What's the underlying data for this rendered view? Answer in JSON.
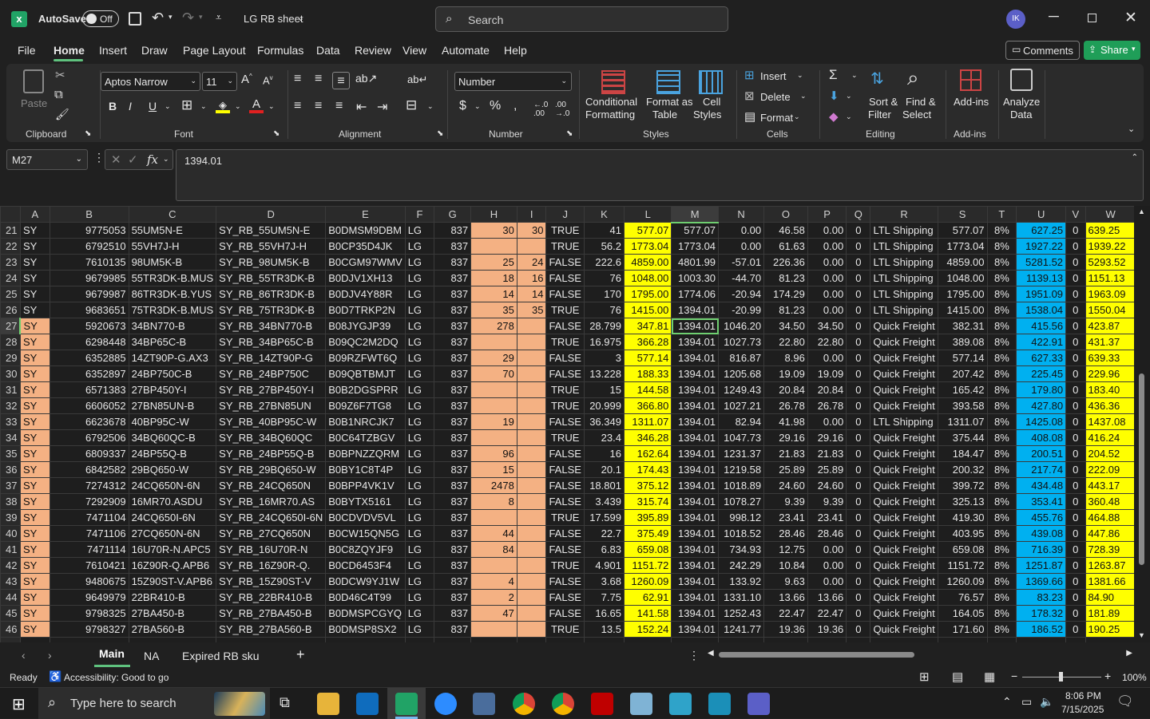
{
  "window": {
    "autosave_label": "AutoSave",
    "autosave_state": "Off",
    "title": "LG RB sheet",
    "search_placeholder": "Search",
    "user_initials": "IK"
  },
  "menu": {
    "items": [
      "File",
      "Home",
      "Insert",
      "Draw",
      "Page Layout",
      "Formulas",
      "Data",
      "Review",
      "View",
      "Automate",
      "Help"
    ],
    "active": "Home",
    "comments": "Comments",
    "share": "Share"
  },
  "ribbon": {
    "paste": "Paste",
    "font_name": "Aptos Narrow",
    "font_size": "11",
    "number_format": "Number",
    "conditional_formatting": [
      "Conditional",
      "Formatting"
    ],
    "format_as_table": [
      "Format as",
      "Table"
    ],
    "cell_styles": [
      "Cell",
      "Styles"
    ],
    "insert": "Insert",
    "delete": "Delete",
    "format": "Format",
    "sort_filter": [
      "Sort &",
      "Filter"
    ],
    "find_select": [
      "Find &",
      "Select"
    ],
    "add_ins": "Add-ins",
    "analyze": [
      "Analyze",
      "Data"
    ],
    "groups": [
      "Clipboard",
      "Font",
      "Alignment",
      "Number",
      "Styles",
      "Cells",
      "Editing",
      "Add-ins"
    ]
  },
  "formula": {
    "name_box": "M27",
    "value": "1394.01"
  },
  "columns": [
    "A",
    "B",
    "C",
    "D",
    "E",
    "F",
    "G",
    "H",
    "I",
    "J",
    "K",
    "L",
    "M",
    "N",
    "O",
    "P",
    "Q",
    "R",
    "S",
    "T",
    "U",
    "V",
    "W"
  ],
  "rows": [
    {
      "r": "21",
      "c": [
        "SY",
        "9775053",
        "55UM5N-E",
        "SY_RB_55UM5N-E",
        "B0DMSM9DBM",
        "LG",
        "837",
        "30",
        "30",
        "TRUE",
        "41",
        "577.07",
        "577.07",
        "0.00",
        "46.58",
        "0.00",
        "0",
        "LTL Shipping",
        "577.07",
        "8%",
        "627.25",
        "0",
        "639.25"
      ]
    },
    {
      "r": "22",
      "c": [
        "SY",
        "6792510",
        "55VH7J-H",
        "SY_RB_55VH7J-H",
        "B0CP35D4JK",
        "LG",
        "837",
        "",
        "",
        "TRUE",
        "56.2",
        "1773.04",
        "1773.04",
        "0.00",
        "61.63",
        "0.00",
        "0",
        "LTL Shipping",
        "1773.04",
        "8%",
        "1927.22",
        "0",
        "1939.22"
      ]
    },
    {
      "r": "23",
      "c": [
        "SY",
        "7610135",
        "98UM5K-B",
        "SY_RB_98UM5K-B",
        "B0CGM97WMV",
        "LG",
        "837",
        "25",
        "24",
        "FALSE",
        "222.6",
        "4859.00",
        "4801.99",
        "-57.01",
        "226.36",
        "0.00",
        "0",
        "LTL Shipping",
        "4859.00",
        "8%",
        "5281.52",
        "0",
        "5293.52"
      ]
    },
    {
      "r": "24",
      "c": [
        "SY",
        "9679985",
        "55TR3DK-B.MUS",
        "SY_RB_55TR3DK-B",
        "B0DJV1XH13",
        "LG",
        "837",
        "18",
        "16",
        "FALSE",
        "76",
        "1048.00",
        "1003.30",
        "-44.70",
        "81.23",
        "0.00",
        "0",
        "LTL Shipping",
        "1048.00",
        "8%",
        "1139.13",
        "0",
        "1151.13"
      ]
    },
    {
      "r": "25",
      "c": [
        "SY",
        "9679987",
        "86TR3DK-B.YUS",
        "SY_RB_86TR3DK-B",
        "B0DJV4Y88R",
        "LG",
        "837",
        "14",
        "14",
        "FALSE",
        "170",
        "1795.00",
        "1774.06",
        "-20.94",
        "174.29",
        "0.00",
        "0",
        "LTL Shipping",
        "1795.00",
        "8%",
        "1951.09",
        "0",
        "1963.09"
      ]
    },
    {
      "r": "26",
      "c": [
        "SY",
        "9683651",
        "75TR3DK-B.MUS",
        "SY_RB_75TR3DK-B",
        "B0D7TRKP2N",
        "LG",
        "837",
        "35",
        "35",
        "TRUE",
        "76",
        "1415.00",
        "1394.01",
        "-20.99",
        "81.23",
        "0.00",
        "0",
        "LTL Shipping",
        "1415.00",
        "8%",
        "1538.04",
        "0",
        "1550.04"
      ]
    },
    {
      "r": "27",
      "c": [
        "SY",
        "5920673",
        "34BN770-B",
        "SY_RB_34BN770-B",
        "B08JYGJP39",
        "LG",
        "837",
        "278",
        "",
        "FALSE",
        "28.799",
        "347.81",
        "1394.01",
        "1046.20",
        "34.50",
        "34.50",
        "0",
        "Quick Freight",
        "382.31",
        "8%",
        "415.56",
        "0",
        "423.87"
      ]
    },
    {
      "r": "28",
      "c": [
        "SY",
        "6298448",
        "34BP65C-B",
        "SY_RB_34BP65C-B",
        "B09QC2M2DQ",
        "LG",
        "837",
        "",
        "",
        "TRUE",
        "16.975",
        "366.28",
        "1394.01",
        "1027.73",
        "22.80",
        "22.80",
        "0",
        "Quick Freight",
        "389.08",
        "8%",
        "422.91",
        "0",
        "431.37"
      ]
    },
    {
      "r": "29",
      "c": [
        "SY",
        "6352885",
        "14ZT90P-G.AX3",
        "SY_RB_14ZT90P-G",
        "B09RZFWT6Q",
        "LG",
        "837",
        "29",
        "",
        "FALSE",
        "3",
        "577.14",
        "1394.01",
        "816.87",
        "8.96",
        "0.00",
        "0",
        "Quick Freight",
        "577.14",
        "8%",
        "627.33",
        "0",
        "639.33"
      ]
    },
    {
      "r": "30",
      "c": [
        "SY",
        "6352897",
        "24BP750C-B",
        "SY_RB_24BP750C",
        "B09QBTBMJT",
        "LG",
        "837",
        "70",
        "",
        "FALSE",
        "13.228",
        "188.33",
        "1394.01",
        "1205.68",
        "19.09",
        "19.09",
        "0",
        "Quick Freight",
        "207.42",
        "8%",
        "225.45",
        "0",
        "229.96"
      ]
    },
    {
      "r": "31",
      "c": [
        "SY",
        "6571383",
        "27BP450Y-I",
        "SY_RB_27BP450Y-I",
        "B0B2DGSPRR",
        "LG",
        "837",
        "",
        "",
        "TRUE",
        "15",
        "144.58",
        "1394.01",
        "1249.43",
        "20.84",
        "20.84",
        "0",
        "Quick Freight",
        "165.42",
        "8%",
        "179.80",
        "0",
        "183.40"
      ]
    },
    {
      "r": "32",
      "c": [
        "SY",
        "6606052",
        "27BN85UN-B",
        "SY_RB_27BN85UN",
        "B09Z6F7TG8",
        "LG",
        "837",
        "",
        "",
        "TRUE",
        "20.999",
        "366.80",
        "1394.01",
        "1027.21",
        "26.78",
        "26.78",
        "0",
        "Quick Freight",
        "393.58",
        "8%",
        "427.80",
        "0",
        "436.36"
      ]
    },
    {
      "r": "33",
      "c": [
        "SY",
        "6623678",
        "40BP95C-W",
        "SY_RB_40BP95C-W",
        "B0B1NRCJK7",
        "LG",
        "837",
        "19",
        "",
        "FALSE",
        "36.349",
        "1311.07",
        "1394.01",
        "82.94",
        "41.98",
        "0.00",
        "0",
        "LTL Shipping",
        "1311.07",
        "8%",
        "1425.08",
        "0",
        "1437.08"
      ]
    },
    {
      "r": "34",
      "c": [
        "SY",
        "6792506",
        "34BQ60QC-B",
        "SY_RB_34BQ60QC",
        "B0C64TZBGV",
        "LG",
        "837",
        "",
        "",
        "TRUE",
        "23.4",
        "346.28",
        "1394.01",
        "1047.73",
        "29.16",
        "29.16",
        "0",
        "Quick Freight",
        "375.44",
        "8%",
        "408.08",
        "0",
        "416.24"
      ]
    },
    {
      "r": "35",
      "c": [
        "SY",
        "6809337",
        "24BP55Q-B",
        "SY_RB_24BP55Q-B",
        "B0BPNZZQRM",
        "LG",
        "837",
        "96",
        "",
        "FALSE",
        "16",
        "162.64",
        "1394.01",
        "1231.37",
        "21.83",
        "21.83",
        "0",
        "Quick Freight",
        "184.47",
        "8%",
        "200.51",
        "0",
        "204.52"
      ]
    },
    {
      "r": "36",
      "c": [
        "SY",
        "6842582",
        "29BQ650-W",
        "SY_RB_29BQ650-W",
        "B0BY1C8T4P",
        "LG",
        "837",
        "15",
        "",
        "FALSE",
        "20.1",
        "174.43",
        "1394.01",
        "1219.58",
        "25.89",
        "25.89",
        "0",
        "Quick Freight",
        "200.32",
        "8%",
        "217.74",
        "0",
        "222.09"
      ]
    },
    {
      "r": "37",
      "c": [
        "SY",
        "7274312",
        "24CQ650N-6N",
        "SY_RB_24CQ650N",
        "B0BPP4VK1V",
        "LG",
        "837",
        "2478",
        "",
        "FALSE",
        "18.801",
        "375.12",
        "1394.01",
        "1018.89",
        "24.60",
        "24.60",
        "0",
        "Quick Freight",
        "399.72",
        "8%",
        "434.48",
        "0",
        "443.17"
      ]
    },
    {
      "r": "38",
      "c": [
        "SY",
        "7292909",
        "16MR70.ASDU",
        "SY_RB_16MR70.AS",
        "B0BYTX5161",
        "LG",
        "837",
        "8",
        "",
        "FALSE",
        "3.439",
        "315.74",
        "1394.01",
        "1078.27",
        "9.39",
        "9.39",
        "0",
        "Quick Freight",
        "325.13",
        "8%",
        "353.41",
        "0",
        "360.48"
      ]
    },
    {
      "r": "39",
      "c": [
        "SY",
        "7471104",
        "24CQ650I-6N",
        "SY_RB_24CQ650I-6N",
        "B0CDVDV5VL",
        "LG",
        "837",
        "",
        "",
        "TRUE",
        "17.599",
        "395.89",
        "1394.01",
        "998.12",
        "23.41",
        "23.41",
        "0",
        "Quick Freight",
        "419.30",
        "8%",
        "455.76",
        "0",
        "464.88"
      ]
    },
    {
      "r": "40",
      "c": [
        "SY",
        "7471106",
        "27CQ650N-6N",
        "SY_RB_27CQ650N",
        "B0CW15QN5G",
        "LG",
        "837",
        "44",
        "",
        "FALSE",
        "22.7",
        "375.49",
        "1394.01",
        "1018.52",
        "28.46",
        "28.46",
        "0",
        "Quick Freight",
        "403.95",
        "8%",
        "439.08",
        "0",
        "447.86"
      ]
    },
    {
      "r": "41",
      "c": [
        "SY",
        "7471114",
        "16U70R-N.APC5",
        "SY_RB_16U70R-N",
        "B0C8ZQYJF9",
        "LG",
        "837",
        "84",
        "",
        "FALSE",
        "6.83",
        "659.08",
        "1394.01",
        "734.93",
        "12.75",
        "0.00",
        "0",
        "Quick Freight",
        "659.08",
        "8%",
        "716.39",
        "0",
        "728.39"
      ]
    },
    {
      "r": "42",
      "c": [
        "SY",
        "7610421",
        "16Z90R-Q.APB6",
        "SY_RB_16Z90R-Q.",
        "B0CD6453F4",
        "LG",
        "837",
        "",
        "",
        "TRUE",
        "4.901",
        "1151.72",
        "1394.01",
        "242.29",
        "10.84",
        "0.00",
        "0",
        "Quick Freight",
        "1151.72",
        "8%",
        "1251.87",
        "0",
        "1263.87"
      ]
    },
    {
      "r": "43",
      "c": [
        "SY",
        "9480675",
        "15Z90ST-V.APB6",
        "SY_RB_15Z90ST-V",
        "B0DCW9YJ1W",
        "LG",
        "837",
        "4",
        "",
        "FALSE",
        "3.68",
        "1260.09",
        "1394.01",
        "133.92",
        "9.63",
        "0.00",
        "0",
        "Quick Freight",
        "1260.09",
        "8%",
        "1369.66",
        "0",
        "1381.66"
      ]
    },
    {
      "r": "44",
      "c": [
        "SY",
        "9649979",
        "22BR410-B",
        "SY_RB_22BR410-B",
        "B0D46C4T99",
        "LG",
        "837",
        "2",
        "",
        "FALSE",
        "7.75",
        "62.91",
        "1394.01",
        "1331.10",
        "13.66",
        "13.66",
        "0",
        "Quick Freight",
        "76.57",
        "8%",
        "83.23",
        "0",
        "84.90"
      ]
    },
    {
      "r": "45",
      "c": [
        "SY",
        "9798325",
        "27BA450-B",
        "SY_RB_27BA450-B",
        "B0DMSPCGYQ",
        "LG",
        "837",
        "47",
        "",
        "FALSE",
        "16.65",
        "141.58",
        "1394.01",
        "1252.43",
        "22.47",
        "22.47",
        "0",
        "Quick Freight",
        "164.05",
        "8%",
        "178.32",
        "0",
        "181.89"
      ]
    },
    {
      "r": "46",
      "c": [
        "SY",
        "9798327",
        "27BA560-B",
        "SY_RB_27BA560-B",
        "B0DMSP8SX2",
        "LG",
        "837",
        "",
        "",
        "TRUE",
        "13.5",
        "152.24",
        "1394.01",
        "1241.77",
        "19.36",
        "19.36",
        "0",
        "Quick Freight",
        "171.60",
        "8%",
        "186.52",
        "0",
        "190.25"
      ]
    }
  ],
  "sheets": {
    "tabs": [
      "Main",
      "NA",
      "Expired RB sku"
    ],
    "active": "Main"
  },
  "status": {
    "ready": "Ready",
    "accessibility": "Accessibility: Good to go",
    "zoom": "100%"
  },
  "taskbar": {
    "search_placeholder": "Type here to search",
    "time": "8:06 PM",
    "date": "7/15/2025"
  },
  "colors": {
    "peach": "#f4b183",
    "yellow": "#ffff00",
    "blue": "#00b0f0",
    "excel_green": "#21a366",
    "share_green": "#1f9e58"
  }
}
